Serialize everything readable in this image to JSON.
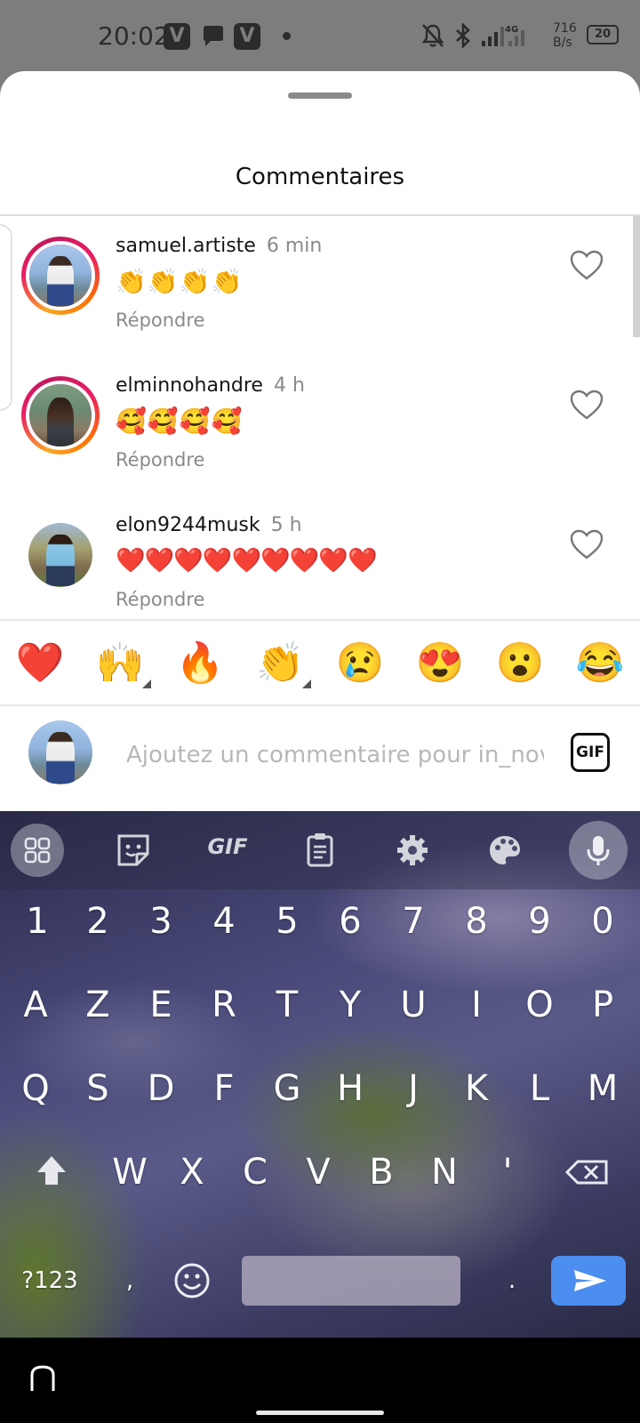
{
  "status_bar": {
    "time": "20:02",
    "app_icon_1": "V",
    "app_icon_2": "V",
    "network_speed_value": "716",
    "network_speed_unit": "B/s",
    "network_type": "4G",
    "battery": "20",
    "icons": [
      "vivaldi-icon",
      "chat-icon",
      "vpn-icon",
      "notifications-off-icon",
      "bluetooth-icon",
      "signal-icon",
      "battery-icon"
    ]
  },
  "sheet": {
    "title": "Commentaires"
  },
  "comments": [
    {
      "username": "samuel.artiste",
      "time": "6 min",
      "text": "👏👏👏👏",
      "reply_label": "Répondre",
      "story_ring": true
    },
    {
      "username": "elminnohandre",
      "time": "4 h",
      "text": "🥰🥰🥰🥰",
      "reply_label": "Répondre",
      "story_ring": true
    },
    {
      "username": "elon9244musk",
      "time": "5 h",
      "text": "❤️❤️❤️❤️❤️❤️❤️❤️❤️",
      "reply_label": "Répondre",
      "story_ring": false
    }
  ],
  "quick_emojis": [
    "❤️",
    "🙌",
    "🔥",
    "👏",
    "😢",
    "😍",
    "😮",
    "😂"
  ],
  "composer": {
    "placeholder": "Ajoutez un commentaire pour in_nova",
    "gif_label": "GIF"
  },
  "keyboard": {
    "toolbar": {
      "gif_label": "GIF",
      "icons": [
        "apps-grid-icon",
        "sticker-icon",
        "gif-icon",
        "clipboard-icon",
        "settings-icon",
        "palette-icon",
        "microphone-icon"
      ]
    },
    "row_numbers": [
      "1",
      "2",
      "3",
      "4",
      "5",
      "6",
      "7",
      "8",
      "9",
      "0"
    ],
    "row_1": [
      "A",
      "Z",
      "E",
      "R",
      "T",
      "Y",
      "U",
      "I",
      "O",
      "P"
    ],
    "row_2": [
      "Q",
      "S",
      "D",
      "F",
      "G",
      "H",
      "J",
      "K",
      "L",
      "M"
    ],
    "row_3": [
      "W",
      "X",
      "C",
      "V",
      "B",
      "N",
      "'"
    ],
    "symbols_label": "?123",
    "comma": ",",
    "period": "."
  },
  "colors": {
    "accent_send": "#4b8ef0",
    "heart_red": "#e0202b",
    "secondary_text": "#8a8a8a"
  }
}
